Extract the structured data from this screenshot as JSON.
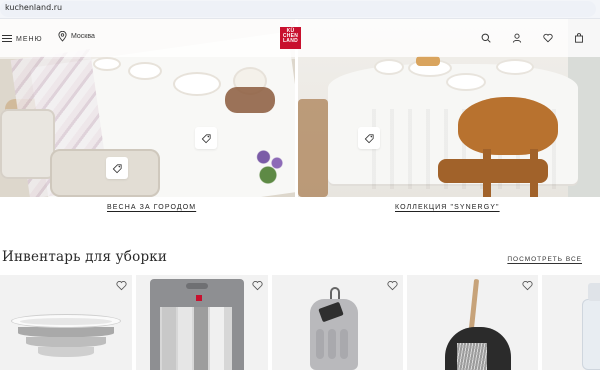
{
  "browser": {
    "url": "kuchenland.ru"
  },
  "header": {
    "menu_label": "МЕНЮ",
    "city": "Москва",
    "logo_lines": [
      "KÜ",
      "CHEN",
      "LAND"
    ],
    "icons": [
      "search-icon",
      "user-icon",
      "heart-icon",
      "bag-icon"
    ]
  },
  "banners": [
    {
      "caption": "ВЕСНА ЗА ГОРОДОМ"
    },
    {
      "caption": "КОЛЛЕКЦИЯ \"SYNERGY\""
    }
  ],
  "section": {
    "title": "Инвентарь для уборки",
    "see_all": "ПОСМОТРЕТЬ ВСЕ"
  },
  "products": [
    {
      "name": "collapsible-bowl"
    },
    {
      "name": "cloth-pack"
    },
    {
      "name": "cleaning-glove"
    },
    {
      "name": "dustpan-brush"
    },
    {
      "name": "spray-bottle"
    }
  ],
  "colors": {
    "brand": "#c8102e",
    "card_bg": "#f2f2f2"
  }
}
